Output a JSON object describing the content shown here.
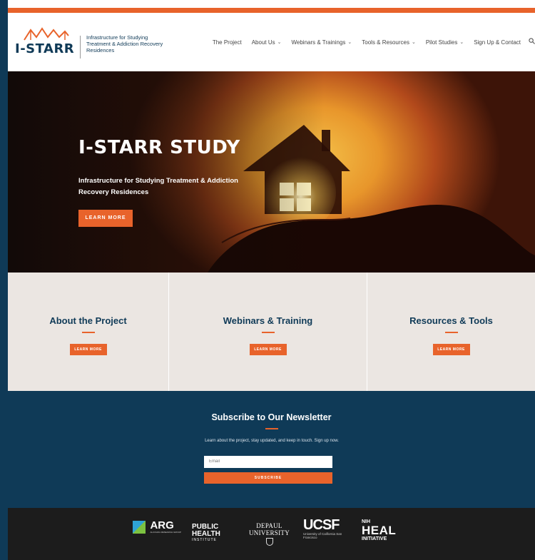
{
  "header": {
    "brand": "I-STARR",
    "tagline": "Infrastructure for Studying Treatment & Addiction Recovery Residences",
    "nav": [
      {
        "label": "The Project",
        "has_dropdown": false
      },
      {
        "label": "About Us",
        "has_dropdown": true
      },
      {
        "label": "Webinars & Trainings",
        "has_dropdown": true
      },
      {
        "label": "Tools & Resources",
        "has_dropdown": true
      },
      {
        "label": "Pilot Studies",
        "has_dropdown": true
      },
      {
        "label": "Sign Up & Contact",
        "has_dropdown": false
      }
    ],
    "search_icon": "search-icon"
  },
  "hero": {
    "title": "I-STARR STUDY",
    "subtitle": "Infrastructure for Studying Treatment & Addiction Recovery Residences",
    "button": "LEARN MORE"
  },
  "cards": [
    {
      "title": "About the Project",
      "button": "LEARN MORE"
    },
    {
      "title": "Webinars & Training",
      "button": "LEARN MORE"
    },
    {
      "title": "Resources & Tools",
      "button": "LEARN MORE"
    }
  ],
  "newsletter": {
    "title": "Subscribe to Our Newsletter",
    "description": "Learn about the project, stay updated, and keep in touch. Sign up now.",
    "email_placeholder": "Email",
    "button": "SUBSCRIBE"
  },
  "footer": {
    "logos": {
      "arg": {
        "name": "ARG",
        "sub": "ALCOHOL RESEARCH GROUP"
      },
      "phi": {
        "line1": "PUBLIC",
        "line2": "HEALTH",
        "line3": "INSTITUTE"
      },
      "depaul": {
        "line1": "DEPAUL",
        "line2": "UNIVERSITY"
      },
      "ucsf": {
        "name": "UCSF",
        "sub": "University of California San Francisco"
      },
      "heal": {
        "nih": "NIH",
        "name": "HEAL",
        "sub": "INITIATIVE"
      }
    }
  },
  "colors": {
    "navy": "#0f3a57",
    "orange": "#e8632b",
    "card_bg": "#ebe6e2",
    "footer_bg": "#1c1c1c"
  }
}
